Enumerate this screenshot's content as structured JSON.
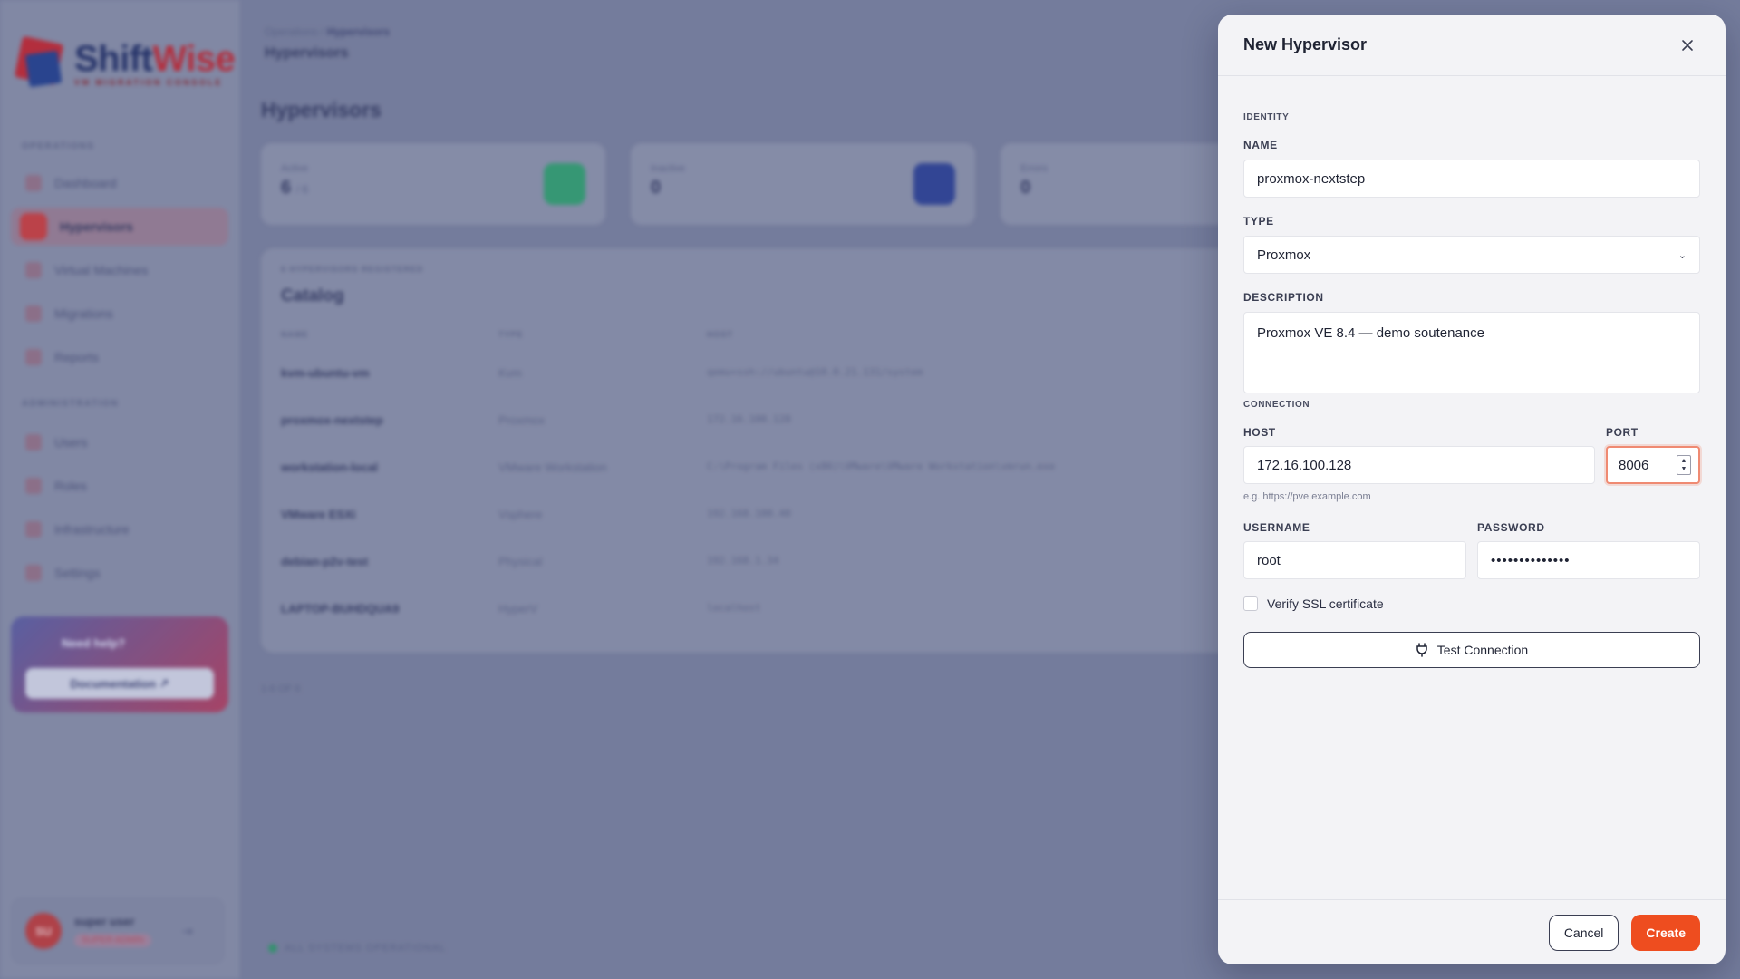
{
  "brand": {
    "name_a": "Shift",
    "name_b": "Wise",
    "subtitle": "VM MIGRATION CONSOLE"
  },
  "sidebar": {
    "section_ops": "OPERATIONS",
    "section_admin": "ADMINISTRATION",
    "ops_items": [
      {
        "label": "Dashboard"
      },
      {
        "label": "Hypervisors"
      },
      {
        "label": "Virtual Machines"
      },
      {
        "label": "Migrations"
      },
      {
        "label": "Reports"
      }
    ],
    "admin_items": [
      {
        "label": "Users"
      },
      {
        "label": "Roles"
      },
      {
        "label": "Infrastructure"
      },
      {
        "label": "Settings"
      }
    ],
    "help": {
      "title": "Need help?",
      "doc_label": "Documentation"
    },
    "user": {
      "initials": "SU",
      "name": "super user",
      "role": "SUPER ADMIN"
    }
  },
  "page": {
    "breadcrumb_root": "Operations",
    "breadcrumb_current": "Hypervisors",
    "top_title": "Hypervisors",
    "heading": "Hypervisors",
    "stats": [
      {
        "label": "Active",
        "value": "6",
        "suffix": "/ 6"
      },
      {
        "label": "Inactive",
        "value": "0"
      },
      {
        "label": "Errors",
        "value": "0"
      }
    ],
    "catalog": {
      "meta": "6 HYPERVISORS REGISTERED",
      "title": "Catalog",
      "headers": [
        "NAME",
        "TYPE",
        "HOST"
      ],
      "rows": [
        {
          "name": "kvm-ubuntu-vm",
          "type": "Kvm",
          "host": "qemu+ssh://ubuntu@10.0.21.131/system"
        },
        {
          "name": "proxmox-nextstep",
          "type": "Proxmox",
          "host": "172.16.100.128"
        },
        {
          "name": "workstation-local",
          "type": "VMware Workstation",
          "host": "C:\\Program Files (x86)\\VMware\\VMware Workstation\\vmrun.exe"
        },
        {
          "name": "VMware ESXi",
          "type": "Vsphere",
          "host": "192.168.100.40"
        },
        {
          "name": "debian-p2v-test",
          "type": "Physical",
          "host": "192.168.1.34"
        },
        {
          "name": "LAPTOP-BUHDQUA9",
          "type": "HyperV",
          "host": "localhost"
        }
      ]
    },
    "pager": "1-6 OF 6",
    "status": "ALL SYSTEMS OPERATIONAL"
  },
  "modal": {
    "title": "New Hypervisor",
    "section_identity": "IDENTITY",
    "name_label": "NAME",
    "name_value": "proxmox-nextstep",
    "type_label": "TYPE",
    "type_value": "Proxmox",
    "description_label": "DESCRIPTION",
    "description_value": "Proxmox VE 8.4 — demo soutenance",
    "section_connection": "CONNECTION",
    "host_label": "HOST",
    "host_value": "172.16.100.128",
    "host_hint": "e.g. https://pve.example.com",
    "port_label": "PORT",
    "port_value": "8006",
    "username_label": "USERNAME",
    "username_value": "root",
    "password_label": "PASSWORD",
    "password_value": "••••••••••••••",
    "verify_ssl_label": "Verify SSL certificate",
    "verify_ssl_checked": false,
    "test_button": "Test Connection",
    "cancel_button": "Cancel",
    "create_button": "Create"
  },
  "colors": {
    "accent": "#ee4d1f",
    "focus_ring": "#ef8a72",
    "brand_red": "#c7232d",
    "brand_navy": "#1c2a63"
  },
  "icons": {
    "close": "close-icon",
    "chevron": "chevron-down-icon",
    "plug": "plug-icon",
    "spinner": "stepper-icon"
  }
}
